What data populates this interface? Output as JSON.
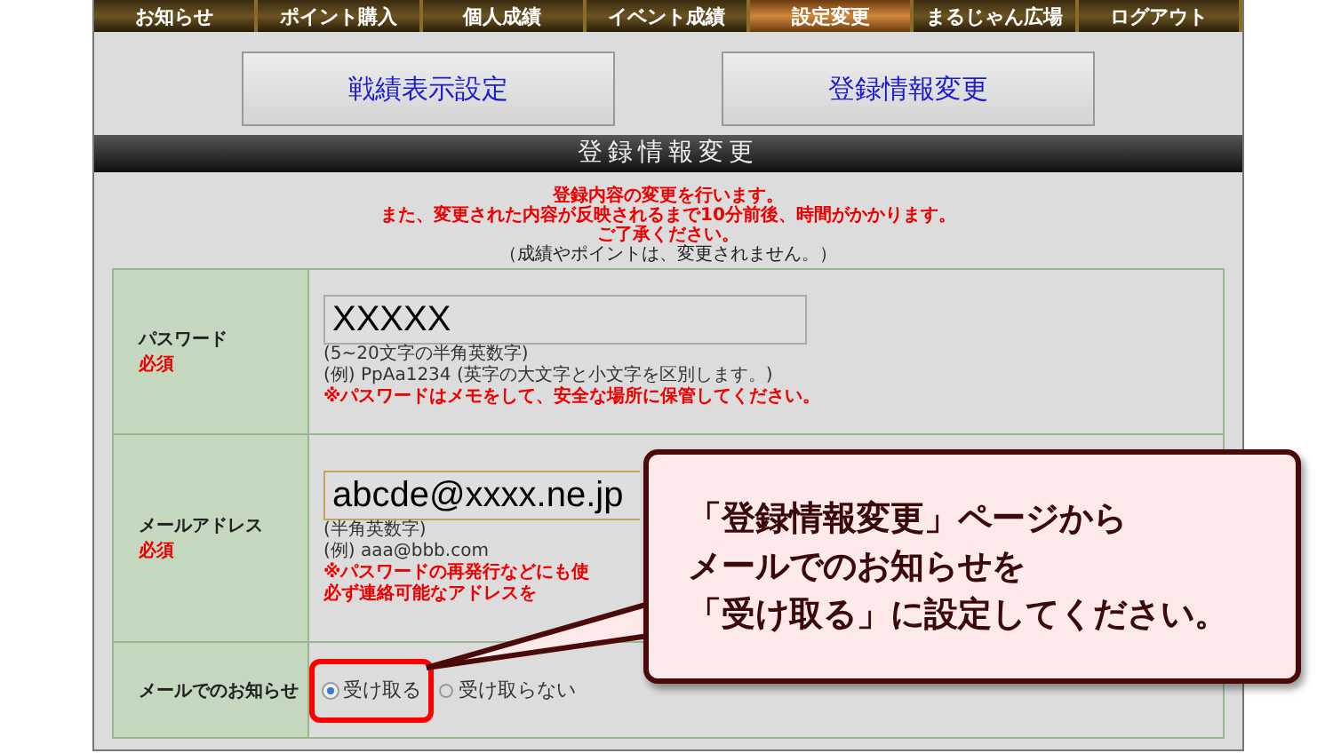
{
  "nav": [
    {
      "label": "お知らせ",
      "selected": false
    },
    {
      "label": "ポイント購入",
      "selected": false
    },
    {
      "label": "個人成績",
      "selected": false
    },
    {
      "label": "イベント成績",
      "selected": false
    },
    {
      "label": "設定変更",
      "selected": true
    },
    {
      "label": "まるじゃん広場",
      "selected": false
    },
    {
      "label": "ログアウト",
      "selected": false
    }
  ],
  "sub_buttons": [
    "戦績表示設定",
    "登録情報変更"
  ],
  "section_title": "登録情報変更",
  "notice": {
    "lines": [
      "登録内容の変更を行います。",
      "また、変更された内容が反映されるまで10分前後、時間がかかります。",
      "ご了承ください。"
    ],
    "note": "（成績やポイントは、変更されません。）"
  },
  "form": [
    {
      "kind": "text",
      "label": "パスワード",
      "required": "必須",
      "value": "XXXXX",
      "hints": [
        "(5~20文字の半角英数字)",
        "(例)  PpAa1234 (英字の大文字と小文字を区別します。)"
      ],
      "warnings": [
        "※パスワードはメモをして、安全な場所に保管してください。"
      ]
    },
    {
      "kind": "email",
      "label": "メールアドレス",
      "required": "必須",
      "value": "abcde@xxxx.ne.jp",
      "hints": [
        "(半角英数字)",
        "(例)  aaa@bbb.com"
      ],
      "warnings": [
        "※パスワードの再発行などにも使",
        "必ず連絡可能なアドレスを"
      ]
    },
    {
      "kind": "radio",
      "label": "メールでのお知らせ",
      "options": [
        {
          "label": "受け取る",
          "selected": true
        },
        {
          "label": "受け取らない",
          "selected": false
        }
      ]
    }
  ],
  "callout": {
    "lines": [
      "「登録情報変更」ページから",
      "メールでのお知らせを",
      "「受け取る」に設定してください。"
    ]
  }
}
